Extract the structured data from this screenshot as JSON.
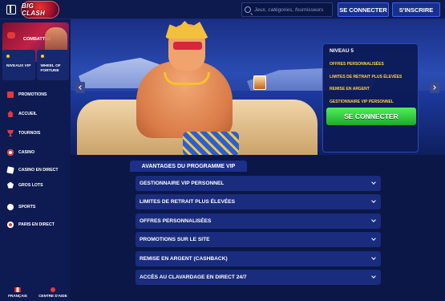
{
  "header": {
    "logo_text": "BIG CLASH",
    "search_placeholder": "Jeux, catégories, fournisseurs",
    "login_label": "SE CONNECTER",
    "signup_label": "S'INSCRIRE"
  },
  "sidebar": {
    "promo_banner_label": "COMBATTEZ",
    "tiles": [
      {
        "label": "NIVEAUX VIP"
      },
      {
        "label": "WHEEL OF FORTUNE"
      }
    ],
    "items": [
      {
        "label": "PROMOTIONS",
        "icon": "gift-icon"
      },
      {
        "label": "ACCUEIL",
        "icon": "home-icon"
      },
      {
        "label": "TOURNOIS",
        "icon": "trophy-icon"
      },
      {
        "label": "CASINO",
        "icon": "casino-chip-icon"
      },
      {
        "label": "CASINO EN DIRECT",
        "icon": "cards-icon"
      },
      {
        "label": "GROS LOTS",
        "icon": "diamond-icon"
      },
      {
        "label": "SPORTS",
        "icon": "soccer-ball-icon"
      },
      {
        "label": "PARIS EN DIRECT",
        "icon": "live-icon"
      }
    ],
    "footer": {
      "language_label": "FRANÇAIS",
      "help_label": "CENTRE D'AIDE"
    }
  },
  "hero": {
    "vip_level_title": "NIVEAU 5",
    "vip_perks": [
      "OFFRES PERSONNALISÉES",
      "LIMITES DE RETRAIT PLUS ÉLEVÉES",
      "REMISE EN ARGENT",
      "GESTIONNAIRE VIP PERSONNEL"
    ],
    "cta_label": "SE CONNECTER"
  },
  "advantages": {
    "section_title": "AVANTAGES DU PROGRAMME VIP",
    "items": [
      "GESTIONNAIRE VIP PERSONNEL",
      "LIMITES DE RETRAIT PLUS ÉLEVÉES",
      "OFFRES PERSONNALISÉES",
      "PROMOTIONS SUR LE SITE",
      "REMISE EN ARGENT (CASHBACK)",
      "ACCÈS AU CLAVARDAGE EN DIRECT 24/7"
    ]
  },
  "colors": {
    "background": "#0b1746",
    "accent_blue": "#3b62ff",
    "cta_green": "#2bc336",
    "perk_yellow": "#ffd53a",
    "brand_red": "#e23a3a"
  }
}
